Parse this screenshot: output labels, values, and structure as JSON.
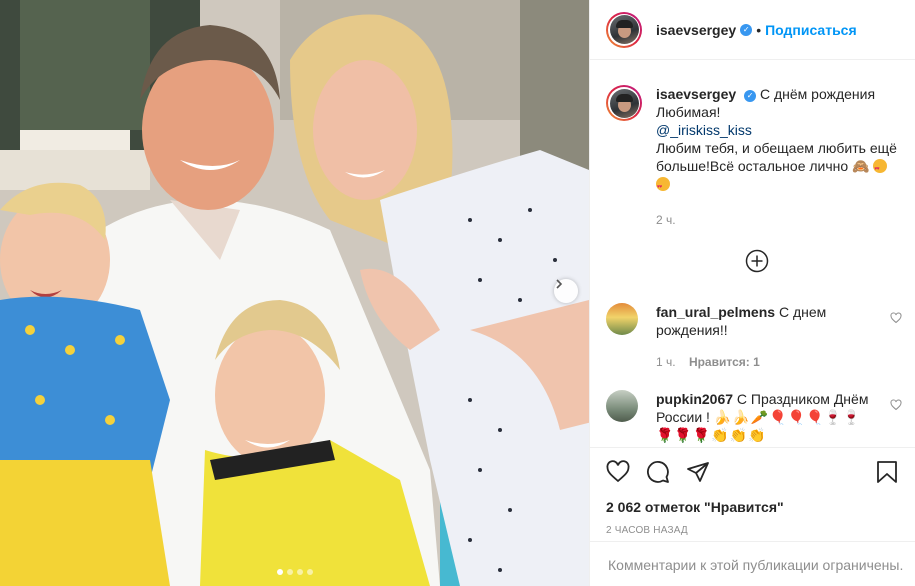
{
  "post": {
    "carousel": {
      "slide_count": 4,
      "active_slide": 1
    }
  },
  "header": {
    "username": "isaevsergey",
    "verified": true,
    "separator": "•",
    "follow_label": "Подписаться"
  },
  "caption": {
    "username": "isaevsergey",
    "line1": "С днём рождения",
    "line2": "Любимая!",
    "mention": "@_iriskiss_kiss",
    "line3": "Любим тебя, и обещаем любить ещё больше!Всё остальное лично 🙈",
    "time": "2 ч."
  },
  "comments": [
    {
      "username": "fan_ural_pelmens",
      "text": "С днем рождения!!",
      "time": "1 ч.",
      "likes": "Нравится: 1"
    },
    {
      "username": "pupkin2067",
      "text": "С Праздником Днём России !"
    }
  ],
  "actions": {
    "likes_text": "2 062 отметок \"Нравится\"",
    "posted_ago": "2 часов назад",
    "comments_closed": "Комментарии к этой публикации ограничены."
  },
  "icons": [
    "heart-icon",
    "comment-icon",
    "share-icon",
    "bookmark-icon",
    "plus-circle-icon",
    "chevron-right-icon",
    "small-heart-icon",
    "verified-badge-icon"
  ],
  "colors": {
    "link": "#0095f6",
    "verified": "#3897f0",
    "muted": "#8e8e8e",
    "border": "#efefef"
  }
}
